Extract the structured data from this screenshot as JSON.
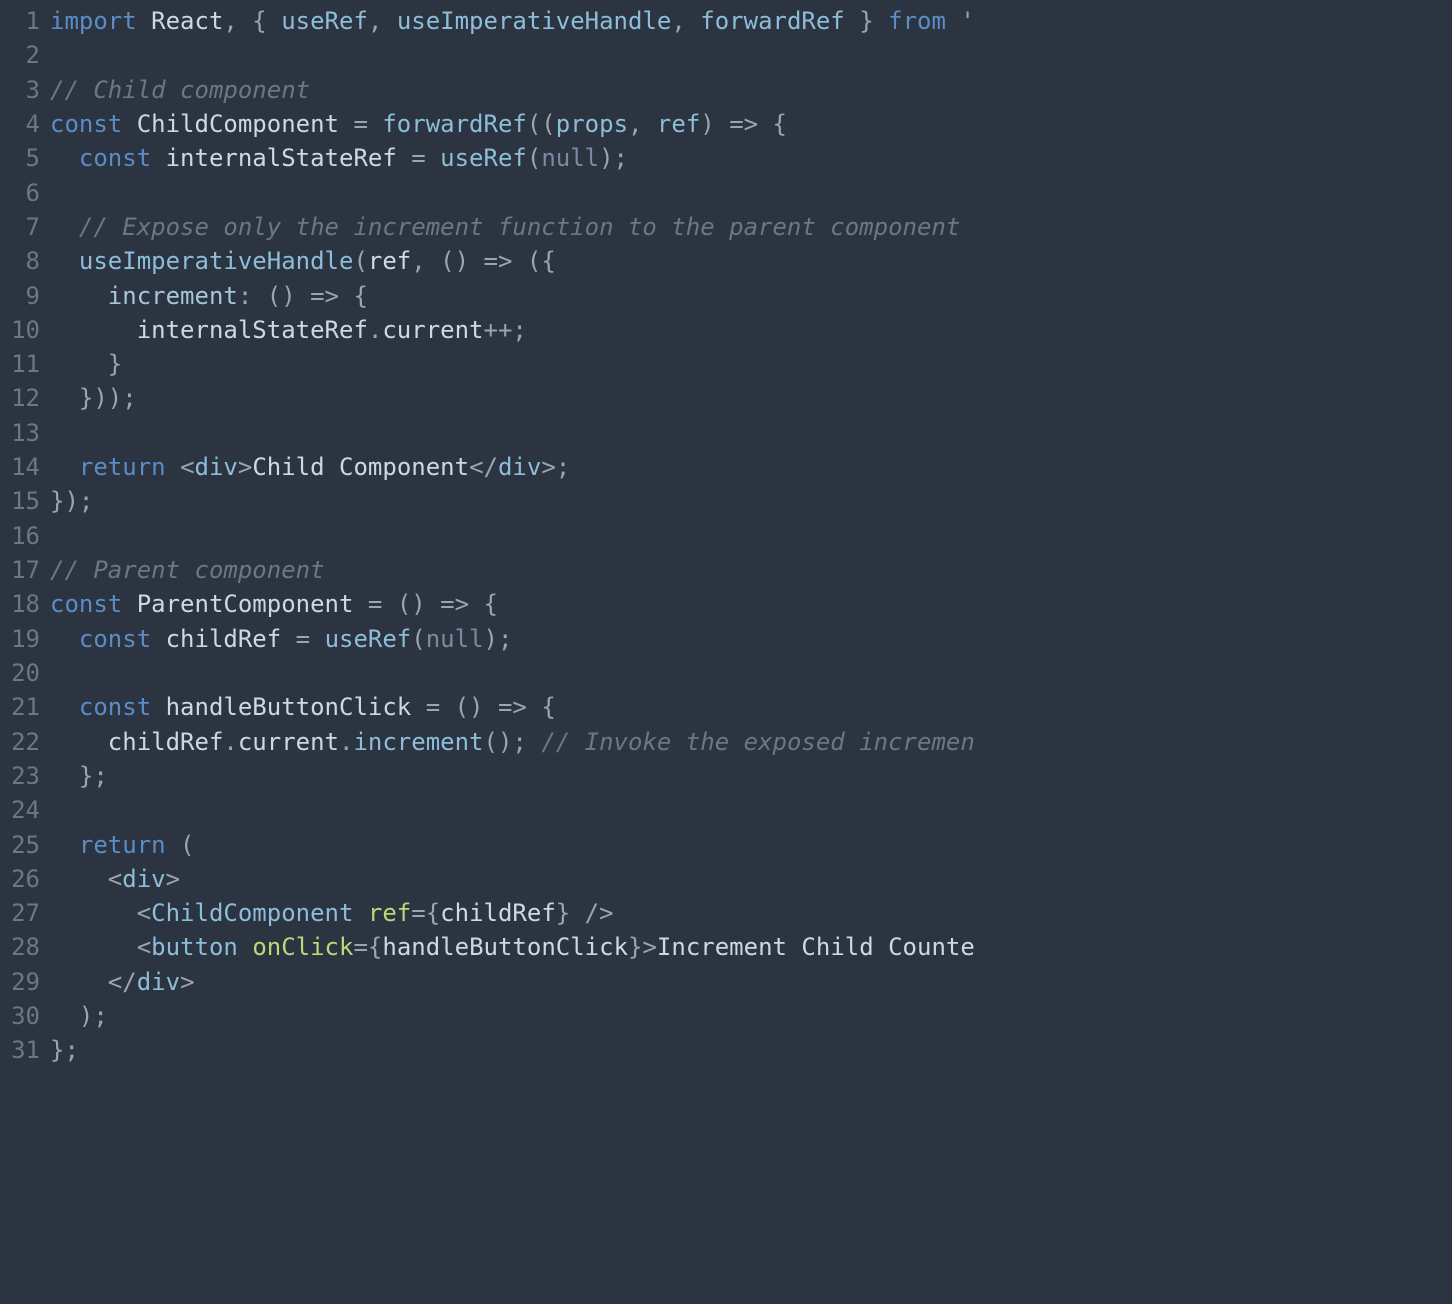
{
  "editor": {
    "language": "jsx",
    "line_count": 31,
    "lines": [
      {
        "n": 1,
        "tokens": [
          {
            "t": "import",
            "c": "tok-kw"
          },
          {
            "t": " "
          },
          {
            "t": "React",
            "c": "tok-id"
          },
          {
            "t": ", { ",
            "c": "tok-punc"
          },
          {
            "t": "useRef",
            "c": "tok-fn"
          },
          {
            "t": ", ",
            "c": "tok-punc"
          },
          {
            "t": "useImperativeHandle",
            "c": "tok-fn"
          },
          {
            "t": ", ",
            "c": "tok-punc"
          },
          {
            "t": "forwardRef",
            "c": "tok-fn"
          },
          {
            "t": " } ",
            "c": "tok-punc"
          },
          {
            "t": "from",
            "c": "tok-kw"
          },
          {
            "t": " '",
            "c": "tok-punc"
          }
        ]
      },
      {
        "n": 2,
        "tokens": []
      },
      {
        "n": 3,
        "tokens": [
          {
            "t": "// Child component",
            "c": "tok-cmt"
          }
        ]
      },
      {
        "n": 4,
        "tokens": [
          {
            "t": "const",
            "c": "tok-kw"
          },
          {
            "t": " "
          },
          {
            "t": "ChildComponent",
            "c": "tok-id"
          },
          {
            "t": " = ",
            "c": "tok-op"
          },
          {
            "t": "forwardRef",
            "c": "tok-fn"
          },
          {
            "t": "((",
            "c": "tok-punc"
          },
          {
            "t": "props",
            "c": "tok-fn"
          },
          {
            "t": ", ",
            "c": "tok-punc"
          },
          {
            "t": "ref",
            "c": "tok-fn"
          },
          {
            "t": ") ",
            "c": "tok-punc"
          },
          {
            "t": "=>",
            "c": "tok-op"
          },
          {
            "t": " {",
            "c": "tok-punc"
          }
        ]
      },
      {
        "n": 5,
        "tokens": [
          {
            "t": "  "
          },
          {
            "t": "const",
            "c": "tok-kw"
          },
          {
            "t": " "
          },
          {
            "t": "internalStateRef",
            "c": "tok-id"
          },
          {
            "t": " = ",
            "c": "tok-op"
          },
          {
            "t": "useRef",
            "c": "tok-fn"
          },
          {
            "t": "(",
            "c": "tok-punc"
          },
          {
            "t": "null",
            "c": "tok-null"
          },
          {
            "t": ");",
            "c": "tok-punc"
          }
        ]
      },
      {
        "n": 6,
        "tokens": []
      },
      {
        "n": 7,
        "tokens": [
          {
            "t": "  "
          },
          {
            "t": "// Expose only the increment function to the parent component",
            "c": "tok-cmt"
          }
        ]
      },
      {
        "n": 8,
        "tokens": [
          {
            "t": "  "
          },
          {
            "t": "useImperativeHandle",
            "c": "tok-fn"
          },
          {
            "t": "(",
            "c": "tok-punc"
          },
          {
            "t": "ref",
            "c": "tok-id"
          },
          {
            "t": ", ",
            "c": "tok-punc"
          },
          {
            "t": "()",
            "c": "tok-punc"
          },
          {
            "t": " => ",
            "c": "tok-op"
          },
          {
            "t": "({",
            "c": "tok-punc"
          }
        ]
      },
      {
        "n": 9,
        "tokens": [
          {
            "t": "    "
          },
          {
            "t": "increment",
            "c": "tok-key"
          },
          {
            "t": ": ",
            "c": "tok-punc"
          },
          {
            "t": "()",
            "c": "tok-punc"
          },
          {
            "t": " => ",
            "c": "tok-op"
          },
          {
            "t": "{",
            "c": "tok-punc"
          }
        ]
      },
      {
        "n": 10,
        "tokens": [
          {
            "t": "      "
          },
          {
            "t": "internalStateRef",
            "c": "tok-id"
          },
          {
            "t": ".",
            "c": "tok-punc"
          },
          {
            "t": "current",
            "c": "tok-id"
          },
          {
            "t": "++;",
            "c": "tok-op"
          }
        ]
      },
      {
        "n": 11,
        "tokens": [
          {
            "t": "    }",
            "c": "tok-punc"
          }
        ]
      },
      {
        "n": 12,
        "tokens": [
          {
            "t": "  }));",
            "c": "tok-punc"
          }
        ]
      },
      {
        "n": 13,
        "tokens": []
      },
      {
        "n": 14,
        "tokens": [
          {
            "t": "  "
          },
          {
            "t": "return",
            "c": "tok-kw"
          },
          {
            "t": " "
          },
          {
            "t": "<",
            "c": "tok-tagp"
          },
          {
            "t": "div",
            "c": "tok-tag"
          },
          {
            "t": ">",
            "c": "tok-tagp"
          },
          {
            "t": "Child Component",
            "c": "tok-text"
          },
          {
            "t": "</",
            "c": "tok-tagp"
          },
          {
            "t": "div",
            "c": "tok-tag"
          },
          {
            "t": ">",
            "c": "tok-tagp"
          },
          {
            "t": ";",
            "c": "tok-punc"
          }
        ]
      },
      {
        "n": 15,
        "tokens": [
          {
            "t": "});",
            "c": "tok-punc"
          }
        ]
      },
      {
        "n": 16,
        "tokens": []
      },
      {
        "n": 17,
        "tokens": [
          {
            "t": "// Parent component",
            "c": "tok-cmt"
          }
        ]
      },
      {
        "n": 18,
        "tokens": [
          {
            "t": "const",
            "c": "tok-kw"
          },
          {
            "t": " "
          },
          {
            "t": "ParentComponent",
            "c": "tok-id"
          },
          {
            "t": " = ",
            "c": "tok-op"
          },
          {
            "t": "()",
            "c": "tok-punc"
          },
          {
            "t": " => ",
            "c": "tok-op"
          },
          {
            "t": "{",
            "c": "tok-punc"
          }
        ]
      },
      {
        "n": 19,
        "tokens": [
          {
            "t": "  "
          },
          {
            "t": "const",
            "c": "tok-kw"
          },
          {
            "t": " "
          },
          {
            "t": "childRef",
            "c": "tok-id"
          },
          {
            "t": " = ",
            "c": "tok-op"
          },
          {
            "t": "useRef",
            "c": "tok-fn"
          },
          {
            "t": "(",
            "c": "tok-punc"
          },
          {
            "t": "null",
            "c": "tok-null"
          },
          {
            "t": ");",
            "c": "tok-punc"
          }
        ]
      },
      {
        "n": 20,
        "tokens": []
      },
      {
        "n": 21,
        "tokens": [
          {
            "t": "  "
          },
          {
            "t": "const",
            "c": "tok-kw"
          },
          {
            "t": " "
          },
          {
            "t": "handleButtonClick",
            "c": "tok-id"
          },
          {
            "t": " = ",
            "c": "tok-op"
          },
          {
            "t": "()",
            "c": "tok-punc"
          },
          {
            "t": " => ",
            "c": "tok-op"
          },
          {
            "t": "{",
            "c": "tok-punc"
          }
        ]
      },
      {
        "n": 22,
        "tokens": [
          {
            "t": "    "
          },
          {
            "t": "childRef",
            "c": "tok-id"
          },
          {
            "t": ".",
            "c": "tok-punc"
          },
          {
            "t": "current",
            "c": "tok-id"
          },
          {
            "t": ".",
            "c": "tok-punc"
          },
          {
            "t": "increment",
            "c": "tok-fn"
          },
          {
            "t": "();",
            "c": "tok-punc"
          },
          {
            "t": " "
          },
          {
            "t": "// Invoke the exposed incremen",
            "c": "tok-cmt"
          }
        ]
      },
      {
        "n": 23,
        "tokens": [
          {
            "t": "  };",
            "c": "tok-punc"
          }
        ]
      },
      {
        "n": 24,
        "tokens": []
      },
      {
        "n": 25,
        "tokens": [
          {
            "t": "  "
          },
          {
            "t": "return",
            "c": "tok-kw"
          },
          {
            "t": " (",
            "c": "tok-punc"
          }
        ]
      },
      {
        "n": 26,
        "tokens": [
          {
            "t": "    "
          },
          {
            "t": "<",
            "c": "tok-tagp"
          },
          {
            "t": "div",
            "c": "tok-tag"
          },
          {
            "t": ">",
            "c": "tok-tagp"
          }
        ]
      },
      {
        "n": 27,
        "tokens": [
          {
            "t": "      "
          },
          {
            "t": "<",
            "c": "tok-tagp"
          },
          {
            "t": "ChildComponent",
            "c": "tok-tag"
          },
          {
            "t": " "
          },
          {
            "t": "ref",
            "c": "tok-attr"
          },
          {
            "t": "=",
            "c": "tok-op"
          },
          {
            "t": "{",
            "c": "tok-punc"
          },
          {
            "t": "childRef",
            "c": "tok-id"
          },
          {
            "t": "}",
            "c": "tok-punc"
          },
          {
            "t": " />",
            "c": "tok-tagp"
          }
        ]
      },
      {
        "n": 28,
        "tokens": [
          {
            "t": "      "
          },
          {
            "t": "<",
            "c": "tok-tagp"
          },
          {
            "t": "button",
            "c": "tok-tag"
          },
          {
            "t": " "
          },
          {
            "t": "onClick",
            "c": "tok-attr"
          },
          {
            "t": "=",
            "c": "tok-op"
          },
          {
            "t": "{",
            "c": "tok-punc"
          },
          {
            "t": "handleButtonClick",
            "c": "tok-id"
          },
          {
            "t": "}",
            "c": "tok-punc"
          },
          {
            "t": ">",
            "c": "tok-tagp"
          },
          {
            "t": "Increment Child Counte",
            "c": "tok-text"
          }
        ]
      },
      {
        "n": 29,
        "tokens": [
          {
            "t": "    "
          },
          {
            "t": "</",
            "c": "tok-tagp"
          },
          {
            "t": "div",
            "c": "tok-tag"
          },
          {
            "t": ">",
            "c": "tok-tagp"
          }
        ]
      },
      {
        "n": 30,
        "tokens": [
          {
            "t": "  );",
            "c": "tok-punc"
          }
        ]
      },
      {
        "n": 31,
        "tokens": [
          {
            "t": "};",
            "c": "tok-punc"
          }
        ]
      }
    ]
  }
}
